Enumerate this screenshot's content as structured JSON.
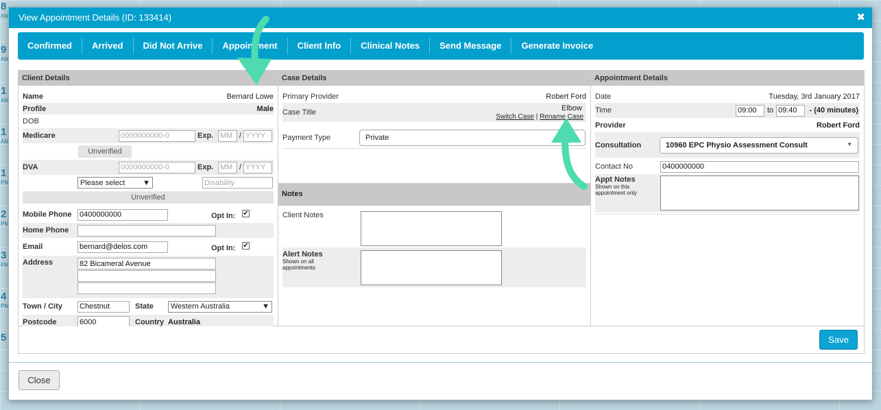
{
  "background": {
    "hours": [
      {
        "num": "8",
        "ap": "AM"
      },
      {
        "num": "9",
        "ap": "AM"
      },
      {
        "num": "1",
        "ap": "AM"
      },
      {
        "num": "1",
        "ap": "AM"
      },
      {
        "num": "1",
        "ap": "PM"
      },
      {
        "num": "2",
        "ap": "PM"
      },
      {
        "num": "3",
        "ap": "PM"
      },
      {
        "num": "4",
        "ap": "PM"
      },
      {
        "num": "5",
        "ap": ""
      }
    ]
  },
  "modal": {
    "title": "View Appointment Details (ID: 133414)",
    "close_glyph": "✖"
  },
  "tabs": [
    "Confirmed",
    "Arrived",
    "Did Not Arrive",
    "Appointment",
    "Client Info",
    "Clinical Notes",
    "Send Message",
    "Generate Invoice"
  ],
  "client": {
    "header": "Client Details",
    "name_label": "Name",
    "name": "Bernard Lowe",
    "profile_label": "Profile",
    "profile": "Male",
    "dob_label": "DOB",
    "medicare_label": "Medicare",
    "medicare_placeholder": "0000000000-0",
    "exp_label": "Exp.",
    "mm_placeholder": "MM",
    "slash": "/",
    "yyyy_placeholder": "YYYY",
    "unverified": "Unverified",
    "dva_label": "DVA",
    "dva_placeholder": "0000000000-0",
    "dva_select": "Please select",
    "disability_placeholder": "Disability",
    "mobile_label": "Mobile Phone",
    "mobile": "0400000000",
    "optin_label": "Opt In:",
    "home_label": "Home Phone",
    "email_label": "Email",
    "email": "bernard@delos.com",
    "address_label": "Address",
    "address1": "82 Bicameral Avenue",
    "town_label": "Town / City",
    "town": "Chestnut",
    "state_label": "State",
    "state": "Western Australia",
    "postcode_label": "Postcode",
    "postcode": "6000",
    "country_label": "Country",
    "country": "Australia"
  },
  "case": {
    "header": "Case Details",
    "primary_label": "Primary Provider",
    "primary": "Robert Ford",
    "title_label": "Case Title",
    "title": "Elbow",
    "switch_case": "Switch Case",
    "sep": "|",
    "rename_case": "Rename Case",
    "payment_label": "Payment Type",
    "payment": "Private",
    "notes_header": "Notes",
    "client_notes_label": "Client Notes",
    "alert_notes_label": "Alert Notes",
    "alert_notes_sub": "Shown on all appointments"
  },
  "appointment": {
    "header": "Appointment Details",
    "date_label": "Date",
    "date": "Tuesday, 3rd January 2017",
    "time_label": "Time",
    "time_from": "09:00",
    "to": "to",
    "time_to": "09:40",
    "duration": "- (40 minutes)",
    "provider_label": "Provider",
    "provider": "Robert Ford",
    "consult_label": "Consultation",
    "consult": "10960 EPC Physio Assessment Consult",
    "contact_label": "Contact No",
    "contact": "0400000000",
    "appt_notes_label": "Appt Notes",
    "appt_notes_sub": "Shown on this appointment only"
  },
  "buttons": {
    "save": "Save",
    "close": "Close"
  },
  "colors": {
    "accent": "#03a0cd",
    "arrow": "#4ddbaf"
  }
}
